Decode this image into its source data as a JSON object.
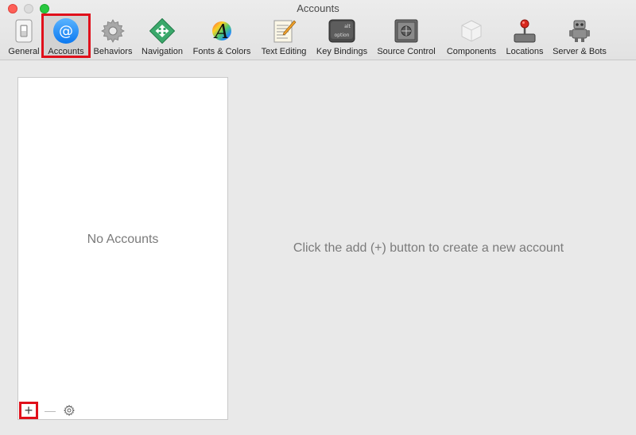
{
  "window": {
    "title": "Accounts"
  },
  "toolbar": {
    "items": [
      {
        "label": "General",
        "icon": "general-switch-icon"
      },
      {
        "label": "Accounts",
        "icon": "at-sign-icon",
        "selected": true
      },
      {
        "label": "Behaviors",
        "icon": "gear-icon"
      },
      {
        "label": "Navigation",
        "icon": "navigation-arrows-icon"
      },
      {
        "label": "Fonts & Colors",
        "icon": "fonts-colors-icon"
      },
      {
        "label": "Text Editing",
        "icon": "text-editing-icon"
      },
      {
        "label": "Key Bindings",
        "icon": "option-key-icon"
      },
      {
        "label": "Source Control",
        "icon": "safe-vault-icon"
      },
      {
        "label": "Components",
        "icon": "component-box-icon"
      },
      {
        "label": "Locations",
        "icon": "joystick-drive-icon"
      },
      {
        "label": "Server & Bots",
        "icon": "robot-icon"
      }
    ],
    "key_glyph_top": "alt",
    "key_glyph_bottom": "option",
    "fonts_glyph": "A"
  },
  "account_list": {
    "empty_text": "No Accounts",
    "add_label": "+",
    "remove_label": "—"
  },
  "detail": {
    "hint": "Click the add (+) button to create a new account"
  },
  "colors": {
    "highlight": "#e0101b",
    "accounts_blue": "#1a8cff",
    "nav_green": "#3aa86b"
  }
}
